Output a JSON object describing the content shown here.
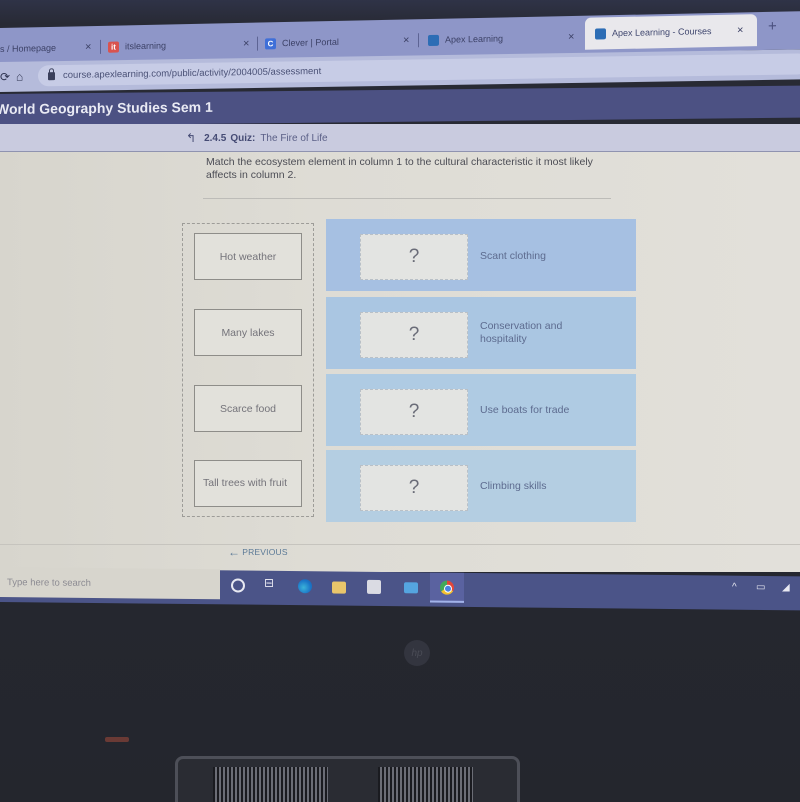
{
  "browser": {
    "tabs": [
      {
        "label": "s / Homepage",
        "favicon": "none",
        "active": false
      },
      {
        "label": "itslearning",
        "favicon": "itslearning-icon",
        "favicon_color": "#d9534f",
        "active": false
      },
      {
        "label": "Clever | Portal",
        "favicon": "clever-icon",
        "favicon_letter": "C",
        "favicon_color": "#3f6fd8",
        "active": false
      },
      {
        "label": "Apex Learning",
        "favicon": "apex-icon",
        "favicon_color": "#2d6db5",
        "active": false
      },
      {
        "label": "Apex Learning - Courses",
        "favicon": "apex-icon",
        "favicon_color": "#2d6db5",
        "active": true
      }
    ],
    "close_glyph": "×",
    "new_tab_glyph": "+",
    "url": "course.apexlearning.com/public/activity/2004005/assessment"
  },
  "course": {
    "title": "World Geography Studies Sem 1",
    "breadcrumb": {
      "up_glyph": "↰",
      "number": "2.4.5",
      "kind": "Quiz:",
      "name": "The Fire of Life"
    }
  },
  "question": {
    "prompt": "Match the ecosystem element in column 1 to the cultural characteristic it most likely affects in column 2.",
    "column1": [
      {
        "label": "Hot weather"
      },
      {
        "label": "Many lakes"
      },
      {
        "label": "Scarce food"
      },
      {
        "label": "Tall trees with fruit"
      }
    ],
    "column2": [
      {
        "slot": "?",
        "label": "Scant clothing"
      },
      {
        "slot": "?",
        "label": "Conservation and hospitality"
      },
      {
        "slot": "?",
        "label": "Use boats for trade"
      },
      {
        "slot": "?",
        "label": "Climbing skills"
      }
    ]
  },
  "navigation": {
    "previous_label": "PREVIOUS",
    "previous_glyph": "←"
  },
  "taskbar": {
    "search_placeholder": "Type here to search",
    "apps": [
      "cortana",
      "task-view",
      "edge",
      "file-explorer",
      "store",
      "mail",
      "chrome"
    ],
    "tray": {
      "chevron": "^"
    }
  },
  "colors": {
    "course_bar": "#4c5183",
    "target_row": "#a9c3e4",
    "taskbar": "#4b5488"
  }
}
